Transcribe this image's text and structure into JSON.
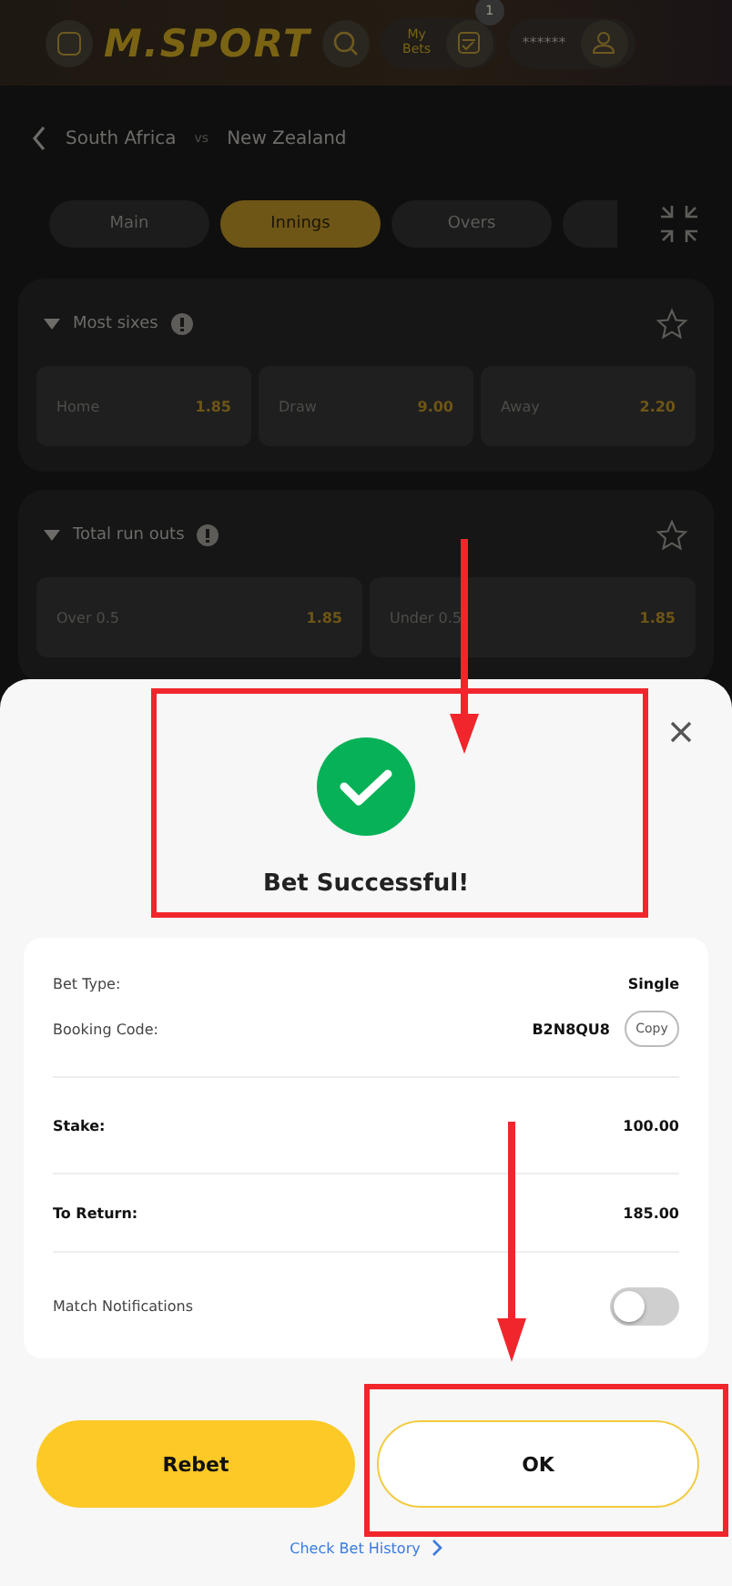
{
  "header": {
    "logo": "M.SPORT",
    "my_bets": "My Bets",
    "bets_count": "1",
    "balance": "******"
  },
  "match": {
    "home": "South Africa",
    "vs": "vs",
    "away": "New Zealand"
  },
  "tabs": [
    {
      "label": "Main",
      "selected": false
    },
    {
      "label": "Innings",
      "selected": true
    },
    {
      "label": "Overs",
      "selected": false
    },
    {
      "selected": false
    }
  ],
  "markets": [
    {
      "title": "Most sixes",
      "expanded": true,
      "outcomes": [
        {
          "label": "Home",
          "odds": "1.85"
        },
        {
          "label": "Draw",
          "odds": "9.00"
        },
        {
          "label": "Away",
          "odds": "2.20"
        }
      ]
    },
    {
      "title": "Total run outs",
      "expanded": true,
      "outcomes": [
        {
          "label": "Over 0.5",
          "odds": "1.85"
        },
        {
          "label": "Under 0.5",
          "odds": "1.85"
        }
      ]
    }
  ],
  "sheet": {
    "title": "Bet Successful!",
    "details": [
      {
        "label": "Bet Type:",
        "value": "Single"
      },
      {
        "label": "Booking Code:",
        "value": "B2N8QU8",
        "action": "Copy"
      }
    ],
    "stake": {
      "label": "Stake:",
      "value": "100.00"
    },
    "to_return": {
      "label": "To Return:",
      "value": "185.00"
    },
    "notifications": {
      "label": "Match Notifications",
      "on": false
    },
    "buttons": {
      "rebet": "Rebet",
      "ok": "OK"
    },
    "link": "Check Bet History"
  }
}
